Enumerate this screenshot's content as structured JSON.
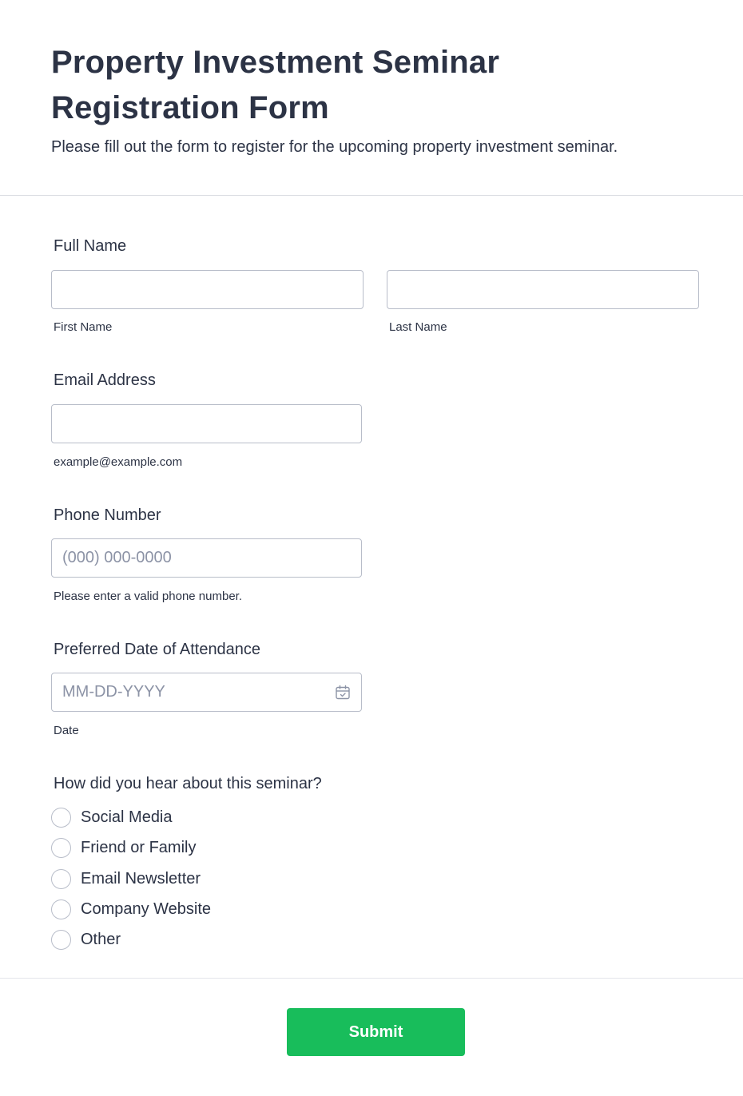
{
  "header": {
    "title": "Property Investment Seminar Registration Form",
    "subtitle": "Please fill out the form to register for the upcoming property investment seminar."
  },
  "full_name": {
    "label": "Full Name",
    "first_sublabel": "First Name",
    "last_sublabel": "Last Name",
    "first_value": "",
    "last_value": ""
  },
  "email": {
    "label": "Email Address",
    "sublabel": "example@example.com",
    "value": ""
  },
  "phone": {
    "label": "Phone Number",
    "placeholder": "(000) 000-0000",
    "sublabel": "Please enter a valid phone number.",
    "value": ""
  },
  "date": {
    "label": "Preferred Date of Attendance",
    "placeholder": "MM-DD-YYYY",
    "sublabel": "Date",
    "icon": "calendar-icon"
  },
  "source": {
    "label": "How did you hear about this seminar?",
    "options": [
      "Social Media",
      "Friend or Family",
      "Email Newsletter",
      "Company Website",
      "Other"
    ]
  },
  "submit": {
    "label": "Submit",
    "color": "#18bd5b"
  }
}
